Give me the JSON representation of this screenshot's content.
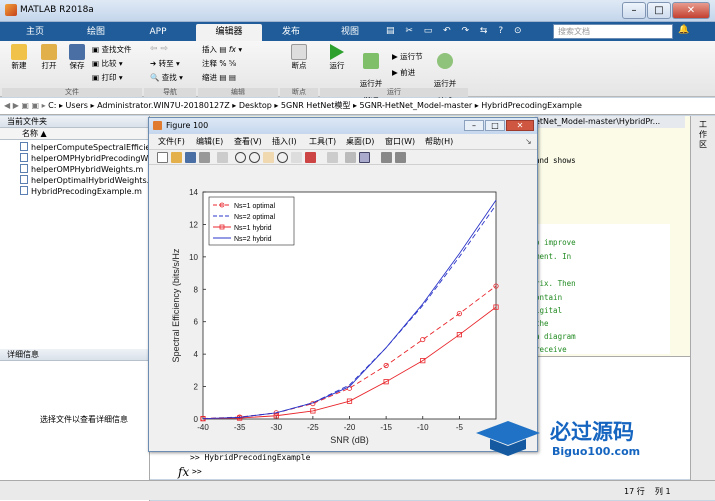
{
  "window": {
    "title": "MATLAB R2018a"
  },
  "tabs": [
    {
      "label": "主页"
    },
    {
      "label": "绘图"
    },
    {
      "label": "APP"
    },
    {
      "label": "编辑器"
    },
    {
      "label": "发布"
    },
    {
      "label": "视图"
    }
  ],
  "search_placeholder": "搜索文档",
  "ribbon": {
    "new": "新建",
    "open": "打开",
    "save": "保存",
    "find_files": "查找文件",
    "compare": "比较",
    "print": "打印",
    "goto": "转至",
    "find": "查找",
    "insert": "插入",
    "comment": "注释",
    "indent": "缩进",
    "fx": "fx",
    "breakpoints": "断点",
    "run": "运行",
    "run_advance": "运行并\n前进",
    "run_section": "运行节",
    "advance": "前进",
    "run_time": "运行并\n计时",
    "groups": {
      "file": "文件",
      "nav": "导航",
      "edit": "编辑",
      "bp": "断点",
      "run": "运行"
    }
  },
  "address": {
    "drive": "C:",
    "parts": [
      "Users",
      "Administrator.WIN7U-20180127Z",
      "Desktop",
      "5GNR HetNet模型",
      "5GNR-HetNet_Model-master",
      "HybridPrecodingExample"
    ]
  },
  "left_panel": {
    "title": "当前文件夹",
    "col_name": "名称",
    "files": [
      "helperComputeSpectralEfficiency.m",
      "helperOMPHybridPrecodingWeights.m",
      "helperOMPHybridWeights.m",
      "helperOptimalHybridWeights.m",
      "HybridPrecodingExample.m"
    ],
    "details_title": "详细信息",
    "details_hint": "选择文件以查看详细信息"
  },
  "editor_tab": "etNet_Model-master\\HybridPr...",
  "editor_lines": [
    "and shows",
    "o improve",
    "ment. In",
    "rix. Then",
    "ontain",
    "igital",
    "the",
    "a diagram",
    "receive"
  ],
  "command": {
    "history": ">> HybridPrecodingExample",
    "prompt": ">>",
    "fx": "fx"
  },
  "right_strip": "工作区",
  "status": {
    "row_label": "行",
    "row": "17",
    "col_label": "列",
    "col": "1"
  },
  "figure": {
    "title": "Figure 100",
    "menu": [
      "文件(F)",
      "编辑(E)",
      "查看(V)",
      "插入(I)",
      "工具(T)",
      "桌面(D)",
      "窗口(W)",
      "帮助(H)"
    ]
  },
  "chart_data": {
    "type": "line",
    "xlabel": "SNR (dB)",
    "ylabel": "Spectral Efficiency (bits/s/Hz",
    "xlim": [
      -40,
      0
    ],
    "ylim": [
      0,
      14
    ],
    "xticks": [
      -40,
      -35,
      -30,
      -25,
      -20,
      -15,
      -10,
      -5
    ],
    "yticks": [
      0,
      2,
      4,
      6,
      8,
      10,
      12,
      14
    ],
    "legend_position": "top-left",
    "x": [
      -40,
      -35,
      -30,
      -25,
      -20,
      -15,
      -10,
      -5,
      0
    ],
    "series": [
      {
        "name": "Ns=1 optimal",
        "color": "#e8262b",
        "dash": true,
        "marker": "circle",
        "values": [
          0.03,
          0.12,
          0.38,
          0.95,
          1.9,
          3.3,
          4.9,
          6.5,
          8.2
        ]
      },
      {
        "name": "Ns=2 optimal",
        "color": "#2b35c8",
        "dash": true,
        "marker": "none",
        "values": [
          0.02,
          0.1,
          0.38,
          1.0,
          2.1,
          4.4,
          7.0,
          10.0,
          13.2
        ]
      },
      {
        "name": "Ns=1 hybrid",
        "color": "#e8262b",
        "dash": false,
        "marker": "square",
        "values": [
          0.02,
          0.06,
          0.2,
          0.5,
          1.1,
          2.3,
          3.6,
          5.2,
          6.9
        ]
      },
      {
        "name": "Ns=2 hybrid",
        "color": "#2b35c8",
        "dash": false,
        "marker": "none",
        "values": [
          0.02,
          0.1,
          0.38,
          1.0,
          2.0,
          4.4,
          7.1,
          10.2,
          13.5
        ]
      }
    ]
  },
  "watermark": {
    "main": "必过源码",
    "sub": "Biguo100.com"
  }
}
